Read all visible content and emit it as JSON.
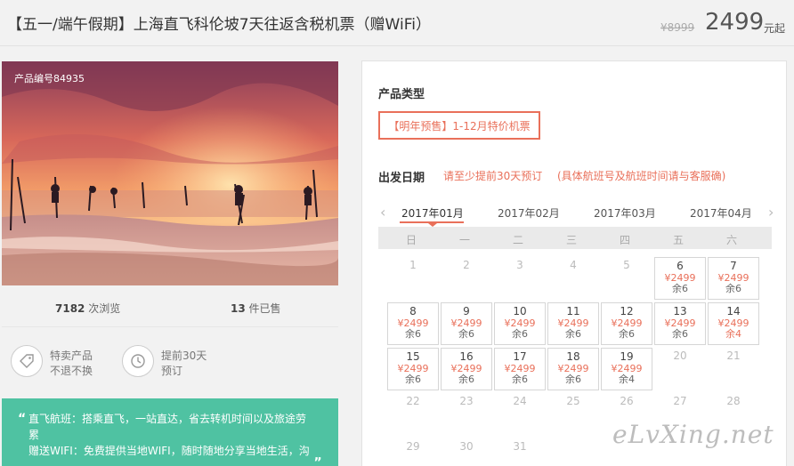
{
  "header": {
    "title": "【五一/端午假期】上海直飞科伦坡7天往返含税机票（赠WiFi）",
    "original_price": "¥8999",
    "price": "2499",
    "price_suffix": "元起"
  },
  "gallery": {
    "product_no": "产品编号84935"
  },
  "stats": {
    "views_num": "7182",
    "views_label": "次浏览",
    "sold_num": "13",
    "sold_label": "件已售"
  },
  "features": [
    {
      "icon": "tag-icon",
      "line1": "特卖产品",
      "line2": "不退不换"
    },
    {
      "icon": "clock-icon",
      "line1": "提前30天",
      "line2": "预订"
    }
  ],
  "promo": {
    "line1": "直飞航班：搭乘直飞，一站直达，省去转机时间以及旅途劳",
    "line2": "累",
    "line3": "赠送WIFI：免费提供当地WIFI，随时随地分享当地生活，沟",
    "quote_open": "“",
    "quote_close": "„"
  },
  "booking": {
    "product_type_label": "产品类型",
    "product_type_option": "【明年预售】1-12月特价机票",
    "departure_label": "出发日期",
    "note1": "请至少提前30天预订",
    "note2": "(具体航班号及航班时间请与客服确)",
    "prev_arrow": "‹",
    "next_arrow": "›",
    "months": [
      "2017年01月",
      "2017年02月",
      "2017年03月",
      "2017年04月"
    ],
    "active_month": 0,
    "weekdays": [
      "日",
      "一",
      "二",
      "三",
      "四",
      "五",
      "六"
    ],
    "days": [
      {
        "d": "1"
      },
      {
        "d": "2"
      },
      {
        "d": "3"
      },
      {
        "d": "4"
      },
      {
        "d": "5"
      },
      {
        "d": "6",
        "price": "¥2499",
        "rem": "余6"
      },
      {
        "d": "7",
        "price": "¥2499",
        "rem": "余6"
      },
      {
        "d": "8",
        "price": "¥2499",
        "rem": "余6"
      },
      {
        "d": "9",
        "price": "¥2499",
        "rem": "余6"
      },
      {
        "d": "10",
        "price": "¥2499",
        "rem": "余6"
      },
      {
        "d": "11",
        "price": "¥2499",
        "rem": "余6"
      },
      {
        "d": "12",
        "price": "¥2499",
        "rem": "余6"
      },
      {
        "d": "13",
        "price": "¥2499",
        "rem": "余6"
      },
      {
        "d": "14",
        "price": "¥2499",
        "rem": "余4",
        "hot": true
      },
      {
        "d": "15",
        "price": "¥2499",
        "rem": "余6"
      },
      {
        "d": "16",
        "price": "¥2499",
        "rem": "余6"
      },
      {
        "d": "17",
        "price": "¥2499",
        "rem": "余6"
      },
      {
        "d": "18",
        "price": "¥2499",
        "rem": "余6"
      },
      {
        "d": "19",
        "price": "¥2499",
        "rem": "余4"
      },
      {
        "d": "20"
      },
      {
        "d": "21"
      },
      {
        "d": "22"
      },
      {
        "d": "23"
      },
      {
        "d": "24"
      },
      {
        "d": "25"
      },
      {
        "d": "26"
      },
      {
        "d": "27"
      },
      {
        "d": "28"
      },
      {
        "d": "29"
      },
      {
        "d": "30"
      },
      {
        "d": "31"
      }
    ],
    "first_weekday": 0
  },
  "watermark": "eLvXing.net",
  "colors": {
    "accent": "#e9705a",
    "promo_bg": "#4fc2a2"
  }
}
